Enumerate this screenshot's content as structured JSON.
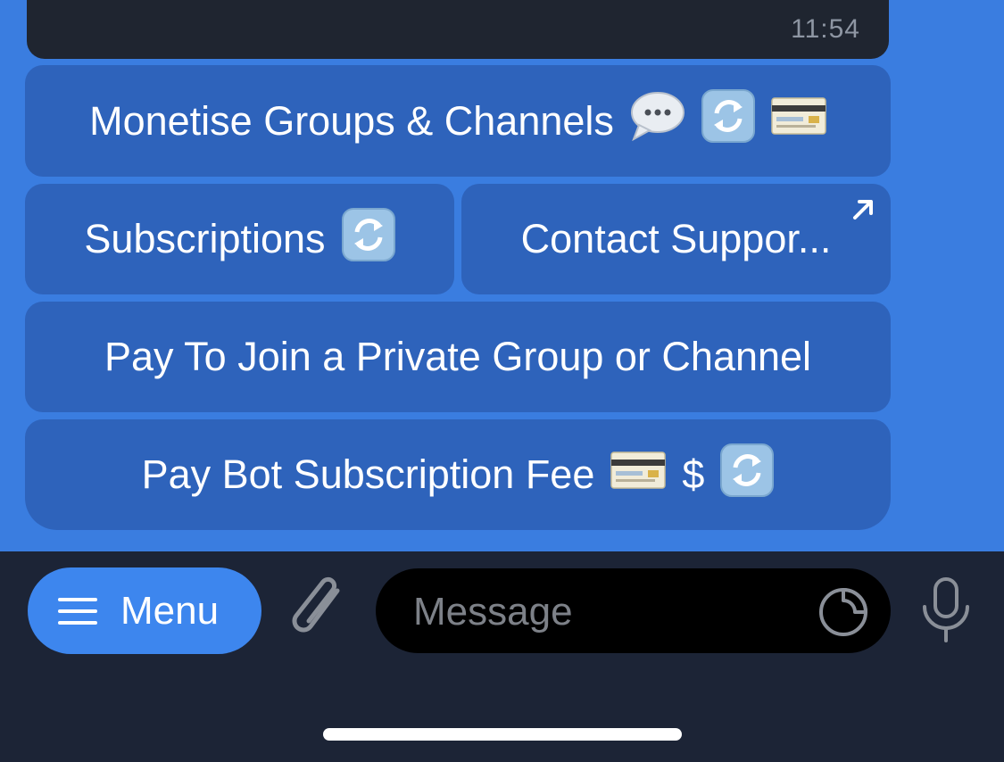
{
  "message": {
    "time": "11:54"
  },
  "keyboard": {
    "monetise_label": "Monetise Groups & Channels",
    "monetise_emojis": [
      "speech-bubble-icon",
      "refresh-icon",
      "credit-card-icon"
    ],
    "subscriptions_label": "Subscriptions",
    "contact_support_label": "Contact Suppor...",
    "pay_join_label": "Pay To Join a Private Group or Channel",
    "pay_fee_label": "Pay Bot Subscription Fee",
    "pay_fee_dollar": "$"
  },
  "input_bar": {
    "menu_label": "Menu",
    "message_placeholder": "Message"
  },
  "colors": {
    "chat_background": "#3a7de0",
    "keyboard_button": "#2e63bb",
    "bottom_bar": "#1c2436",
    "menu_button": "#3d86ee"
  }
}
